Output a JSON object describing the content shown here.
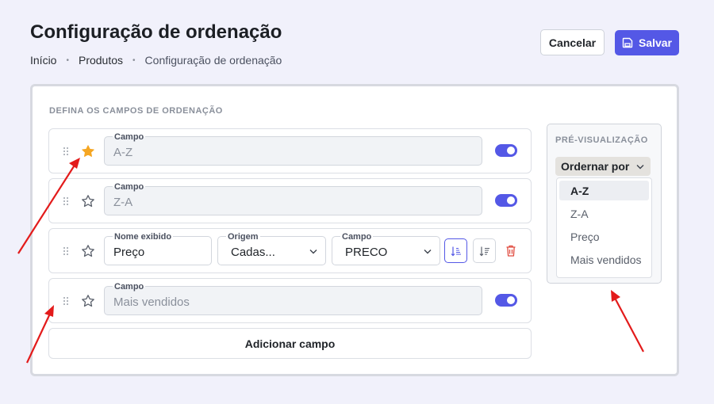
{
  "header": {
    "title": "Configuração de ordenação",
    "breadcrumb": [
      "Início",
      "Produtos",
      "Configuração de ordenação"
    ],
    "cancel_label": "Cancelar",
    "save_label": "Salvar"
  },
  "card": {
    "section_title": "DEFINA OS CAMPOS DE ORDENAÇÃO",
    "rows": [
      {
        "field_label": "Campo",
        "field_value": "A-Z",
        "starred": true,
        "enabled": true
      },
      {
        "field_label": "Campo",
        "field_value": "Z-A",
        "starred": false,
        "enabled": true
      },
      {
        "display_name_label": "Nome exibido",
        "display_name_value": "Preço",
        "origin_label": "Origem",
        "origin_value": "Cadas...",
        "field_label": "Campo",
        "field_value": "PRECO",
        "starred": false
      },
      {
        "field_label": "Campo",
        "field_value": "Mais vendidos",
        "starred": false,
        "enabled": true
      }
    ],
    "add_label": "Adicionar campo"
  },
  "preview": {
    "title": "PRÉ-VISUALIZAÇÃO",
    "order_button_label": "Ordernar por",
    "options": [
      "A-Z",
      "Z-A",
      "Preço",
      "Mais vendidos"
    ],
    "selected": "A-Z"
  },
  "colors": {
    "accent": "#5458e6",
    "star_active": "#f5a623",
    "danger": "#e04b3f",
    "annotation": "#e31b1b"
  }
}
